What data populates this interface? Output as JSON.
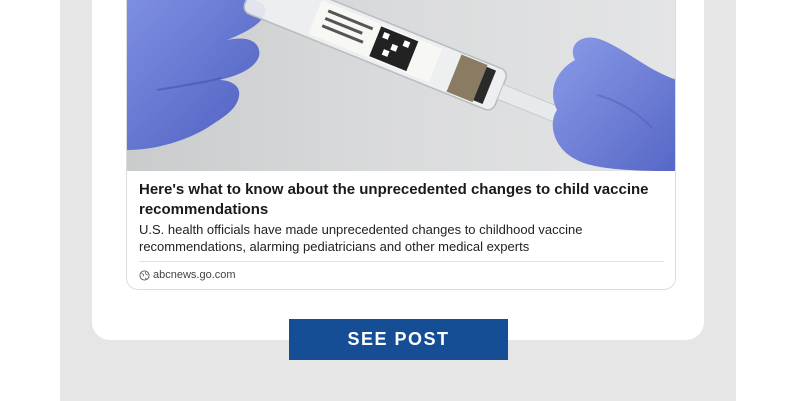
{
  "article": {
    "headline": "Here's what to know about the unprecedented changes to child vaccine recommendations",
    "summary": "U.S. health officials have made unprecedented changes to childhood vaccine recommendations, alarming pediatricians and other medical experts",
    "source": "abcnews.go.com",
    "source_icon": "globe-icon",
    "image_alt": "Gloved hands holding a flu vaccine syringe"
  },
  "cta": {
    "label": "SEE POST"
  },
  "colors": {
    "cta_background": "#164e96",
    "page_backdrop": "#e6e6e6",
    "glove": "#6e7fd6"
  }
}
